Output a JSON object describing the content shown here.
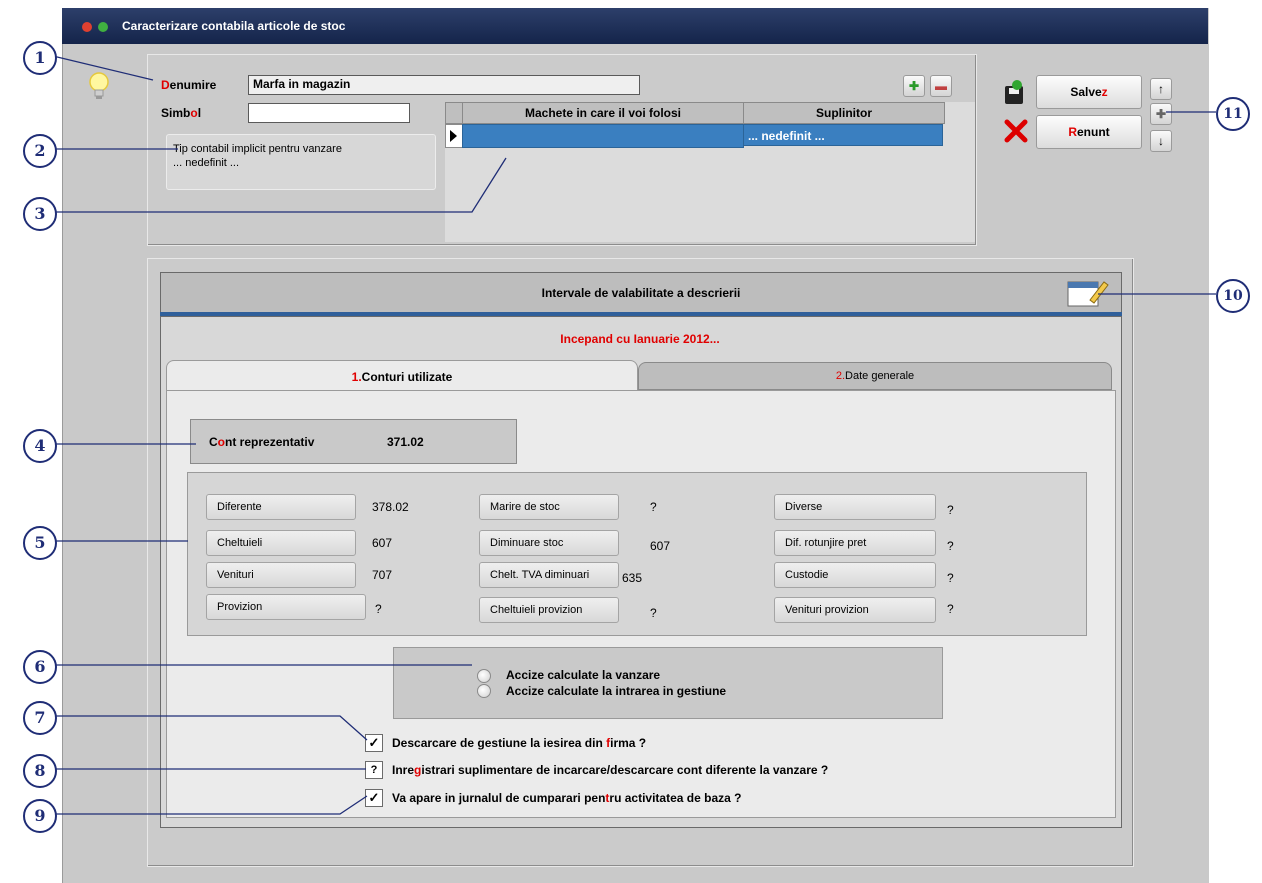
{
  "window": {
    "title": "Caracterizare contabila articole de stoc"
  },
  "form": {
    "denumire_label_first": "D",
    "denumire_label_rest": "enumire",
    "denumire_value": "Marfa in magazin",
    "simbol_label_a": "Simb",
    "simbol_label_b": "o",
    "simbol_label_c": "l",
    "simbol_value": "",
    "tip_contabil_line1": "Tip contabil implicit pentru vanzare",
    "tip_contabil_line2": "... nedefinit ..."
  },
  "grid": {
    "headers": [
      "Machete in care il voi folosi",
      "Suplinitor"
    ],
    "row": {
      "machete": "",
      "suplinitor": "... nedefinit ..."
    }
  },
  "buttons": {
    "save_a": "Salve",
    "save_b": "z",
    "cancel_a": "R",
    "cancel_b": "enunt"
  },
  "validity": {
    "header": "Intervale de valabilitate a descrierii",
    "period": "Incepand cu Ianuarie 2012..."
  },
  "tabs": {
    "tab1_num": "1.",
    "tab1_label": "Conturi utilizate",
    "tab2_num": "2.",
    "tab2_label": "Date generale"
  },
  "cont": {
    "label_a": "C",
    "label_b": "o",
    "label_c": "nt reprezentativ",
    "value": "371.02"
  },
  "accounts": {
    "col1": [
      {
        "label": "Diferente",
        "value": "378.02"
      },
      {
        "label": "Cheltuieli",
        "value": "607"
      },
      {
        "label": "Venituri",
        "value": "707"
      },
      {
        "label": "Provizion",
        "value": "?"
      }
    ],
    "col2": [
      {
        "label": "Marire de stoc",
        "value": "?"
      },
      {
        "label": "Diminuare stoc",
        "value": "607"
      },
      {
        "label": "Chelt. TVA diminuari",
        "value": "635"
      },
      {
        "label": "Cheltuieli provizion",
        "value": "?"
      }
    ],
    "col3": [
      {
        "label": "Diverse",
        "value": "?"
      },
      {
        "label": "Dif. rotunjire pret",
        "value": "?"
      },
      {
        "label": "Custodie",
        "value": "?"
      },
      {
        "label": "Venituri provizion",
        "value": "?"
      }
    ]
  },
  "accize": {
    "opt1": "Accize calculate la vanzare",
    "opt2": "Accize calculate la intrarea in gestiune"
  },
  "checks": {
    "c1_a": "Descarcare de gestiune la iesirea din ",
    "c1_b": "f",
    "c1_c": "irma ?",
    "c1_state": "✓",
    "c2_a": "Inre",
    "c2_b": "g",
    "c2_c": "istrari suplimentare de incarcare/descarcare cont diferente la vanzare ?",
    "c2_state": "?",
    "c3_a": "Va apare in jurnalul de cumparari pen",
    "c3_b": "t",
    "c3_c": "ru activitatea de baza ?",
    "c3_state": "✓"
  },
  "callouts": [
    "1",
    "2",
    "3",
    "4",
    "5",
    "6",
    "7",
    "8",
    "9",
    "10",
    "11"
  ],
  "colors": {
    "title_bar": "#1f3060",
    "accent_red": "#e00000",
    "callout": "#1f2d76",
    "selection": "#3a7fc0"
  }
}
